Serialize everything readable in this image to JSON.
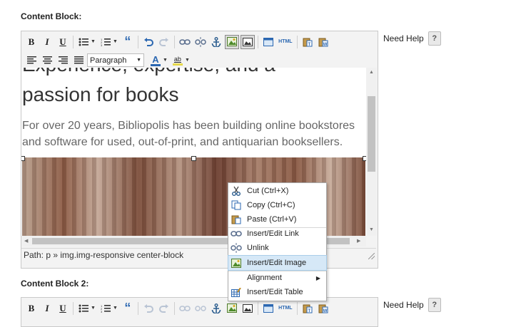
{
  "block1": {
    "label": "Content Block:",
    "toolbar": {
      "bold": "B",
      "italic": "I",
      "underline": "U",
      "quote": "“",
      "html": "HTML",
      "format_select": "Paragraph",
      "font_color": "A",
      "highlight": "ab"
    },
    "heading_partial": "Experience, expertise, and a",
    "heading": "passion for books",
    "paragraph": "For over 20 years, Bibliopolis has been building online bookstores and software for used, out-of-print, and antiquarian booksellers.",
    "status_path": "Path: p » img.img-responsive center-block"
  },
  "help_label": "Need Help",
  "help_button": "?",
  "block2": {
    "label": "Content Block 2:",
    "toolbar": {
      "bold": "B",
      "italic": "I",
      "underline": "U",
      "quote": "“",
      "html": "HTML"
    }
  },
  "context_menu": {
    "items": [
      {
        "label": "Cut (Ctrl+X)",
        "icon": "scissors-icon"
      },
      {
        "label": "Copy (Ctrl+C)",
        "icon": "copy-icon"
      },
      {
        "label": "Paste (Ctrl+V)",
        "icon": "paste-icon"
      },
      {
        "label": "Insert/Edit Link",
        "icon": "link-icon"
      },
      {
        "label": "Unlink",
        "icon": "unlink-icon"
      },
      {
        "label": "Insert/Edit Image",
        "icon": "image-icon",
        "highlighted": true
      },
      {
        "label": "Alignment",
        "icon": "",
        "submenu": true
      },
      {
        "label": "Insert/Edit Table",
        "icon": "table-icon"
      }
    ]
  },
  "colors": {
    "highlight_bg": "#d6e8f7",
    "toolbar_bg": "#f3f3f3",
    "text_blue": "#2b67b1"
  }
}
